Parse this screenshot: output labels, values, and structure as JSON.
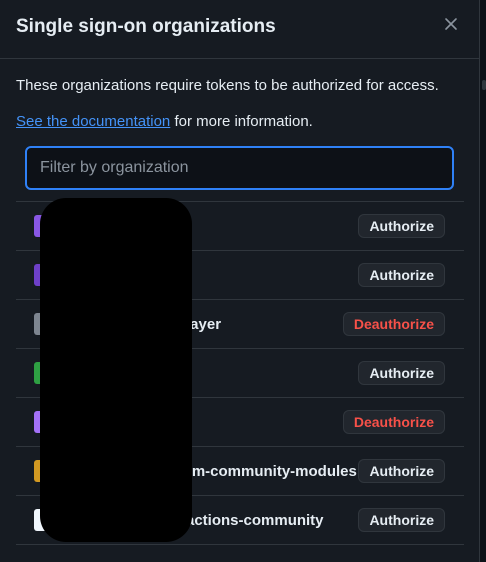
{
  "dialog": {
    "title": "Single sign-on organizations",
    "description": "These organizations require tokens to be authorized for access.",
    "doc_link": "See the documentation",
    "doc_suffix": " for more information."
  },
  "filter": {
    "placeholder": "Filter by organization",
    "value": ""
  },
  "icons": {
    "close": "close-icon",
    "avatar": "org-avatar-icon"
  },
  "organizations": [
    {
      "name": "",
      "action": "Authorize",
      "avatar_color": "#8957e5"
    },
    {
      "name": "",
      "action": "Authorize",
      "avatar_color": "#6e40c9"
    },
    {
      "name": "layer",
      "action": "Deauthorize",
      "avatar_color": "#7d8590"
    },
    {
      "name": "",
      "action": "Authorize",
      "avatar_color": "#2ea043"
    },
    {
      "name": "",
      "action": "Deauthorize",
      "avatar_color": "#a371f7"
    },
    {
      "name": "rm-community-modules",
      "action": "Authorize",
      "avatar_color": "#d29922"
    },
    {
      "name": "actions-community",
      "action": "Authorize",
      "avatar_color": "#f0f6fc"
    }
  ],
  "colors": {
    "link": "#4493f8",
    "danger": "#f85149",
    "focus": "#2f81f7"
  }
}
